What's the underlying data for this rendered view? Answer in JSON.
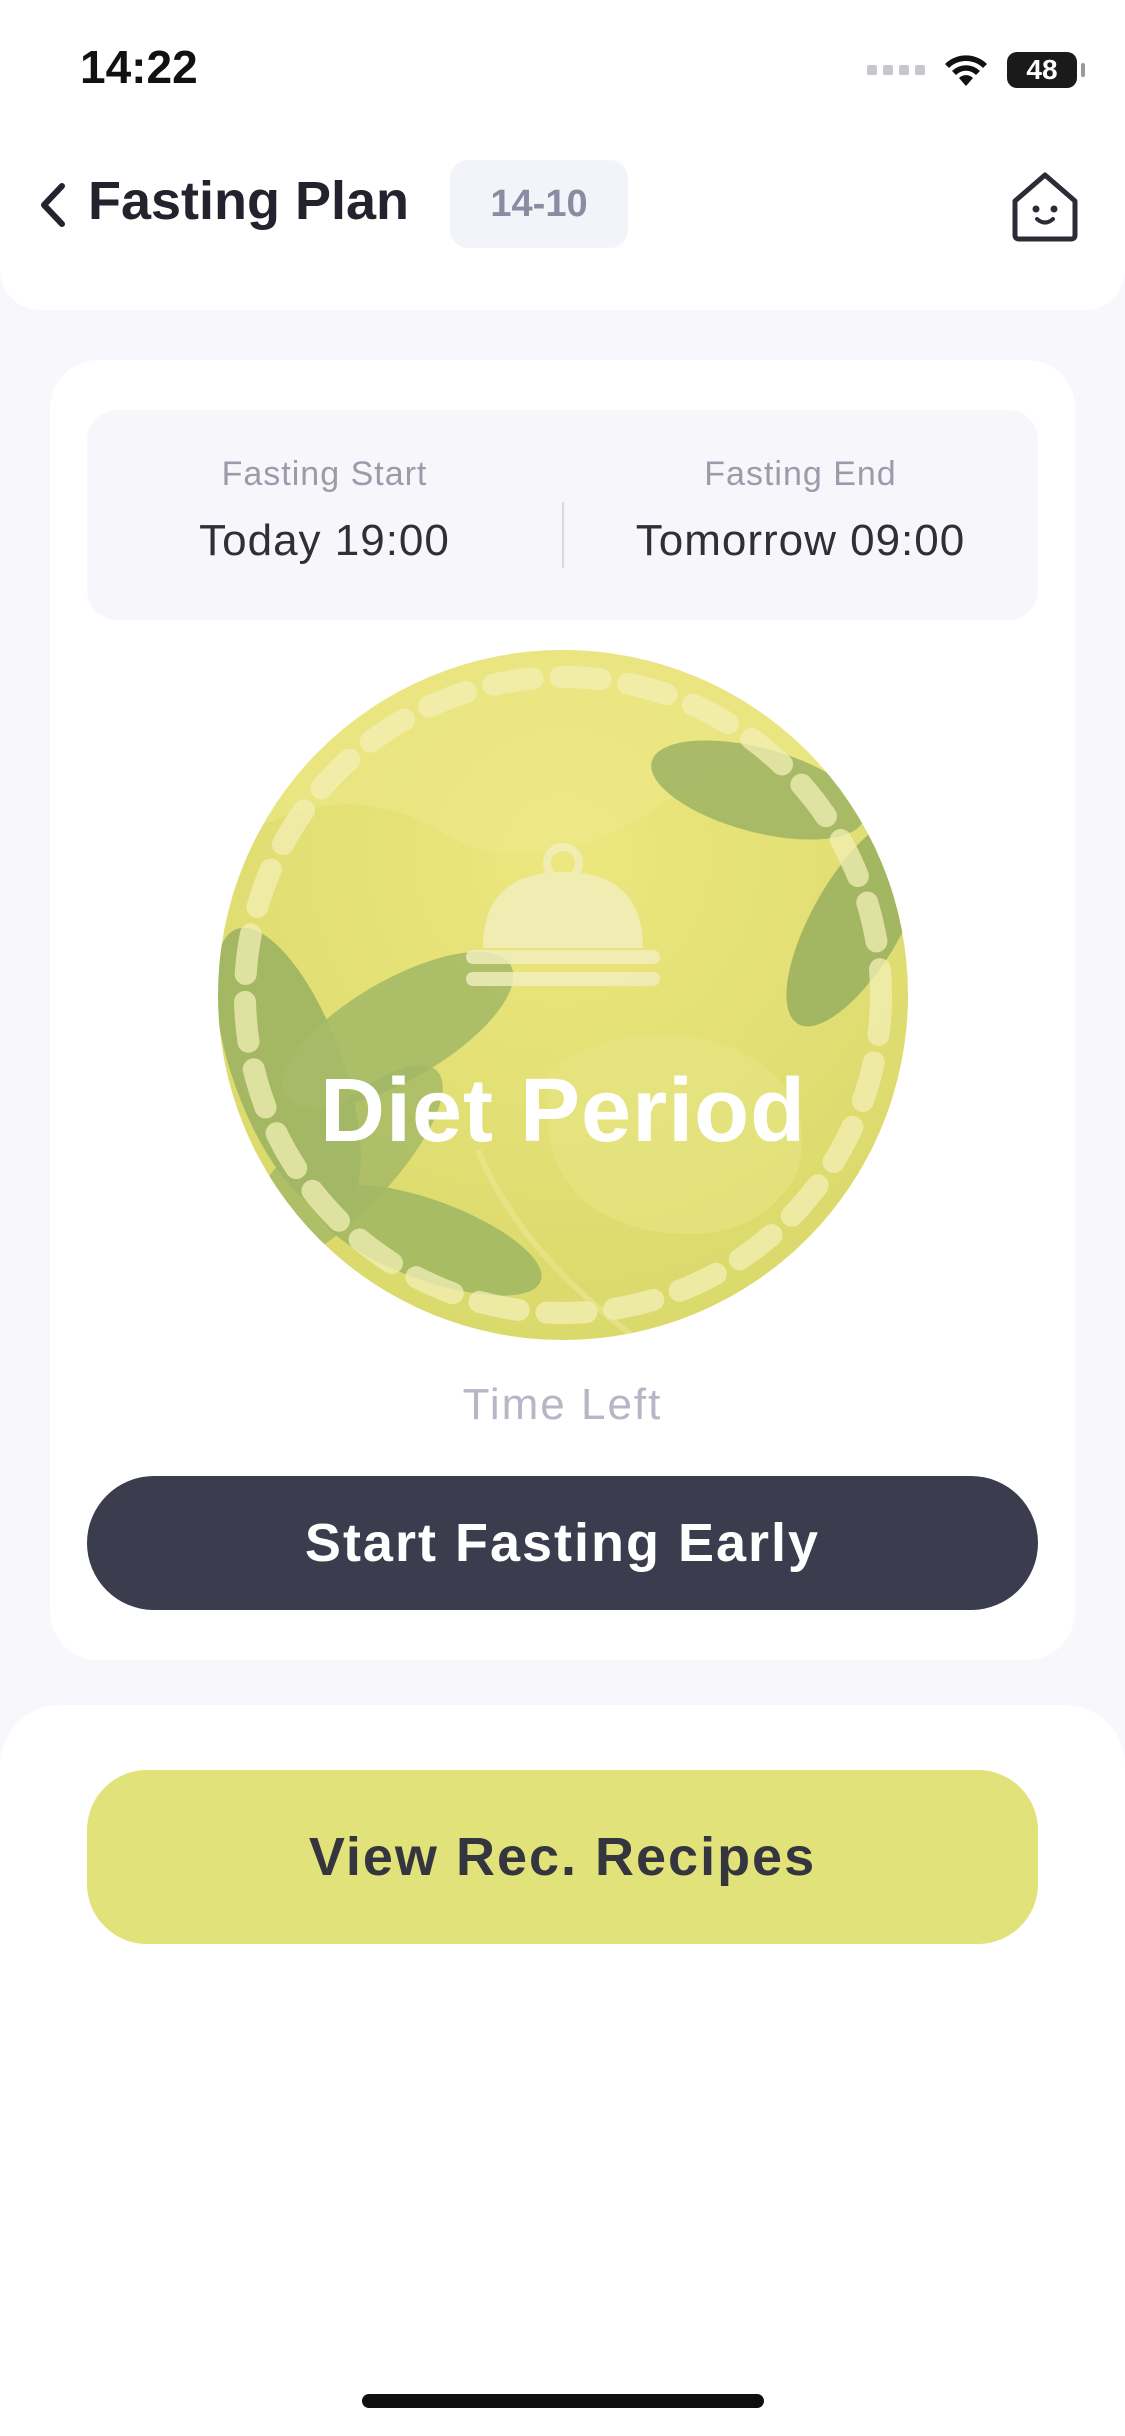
{
  "status_bar": {
    "time": "14:22",
    "battery": "48"
  },
  "header": {
    "title": "Fasting Plan",
    "plan_badge": "14-10"
  },
  "schedule": {
    "start_label": "Fasting Start",
    "start_value": "Today 19:00",
    "end_label": "Fasting End",
    "end_value": "Tomorrow 09:00"
  },
  "period": {
    "label": "Diet Period",
    "time_left_label": "Time Left"
  },
  "actions": {
    "start_early": "Start Fasting Early",
    "view_recipes": "View Rec. Recipes"
  },
  "icons": {
    "back": "chevron-left-icon",
    "home": "home-icon",
    "cloche": "food-cloche-icon"
  },
  "colors": {
    "accent": "#e2e27a",
    "dark_button": "#3b3c4d",
    "circle_fill": "#e3e074",
    "leaf": "#9fb565"
  }
}
